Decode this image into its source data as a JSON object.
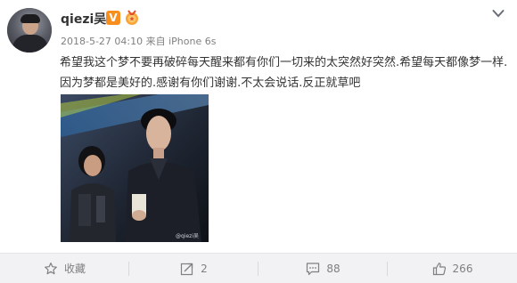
{
  "user": {
    "name": "qiezi吴",
    "verified_badge": "V"
  },
  "post": {
    "meta": "2018-5-27 04:10 来自 iPhone 6s",
    "text": "希望我这个梦不要再破碎每天醒来都有你们一切来的太突然好突然.希望每天都像梦一样.因为梦都是美好的.感谢有你们谢谢.不太会说话.反正就草吧",
    "image_watermark": "@qiezi吴"
  },
  "toolbar": {
    "collect_label": "收藏",
    "repost_count": "2",
    "comment_count": "88",
    "like_count": "266"
  },
  "colors": {
    "badge_orange": "#f78e1e",
    "toolbar_bg": "#f2f2f5",
    "muted_text": "#808080"
  },
  "icons": [
    "avatar",
    "verified-v-icon",
    "medal-icon",
    "chevron-down-icon",
    "star-icon",
    "repost-icon",
    "comment-icon",
    "like-icon"
  ]
}
